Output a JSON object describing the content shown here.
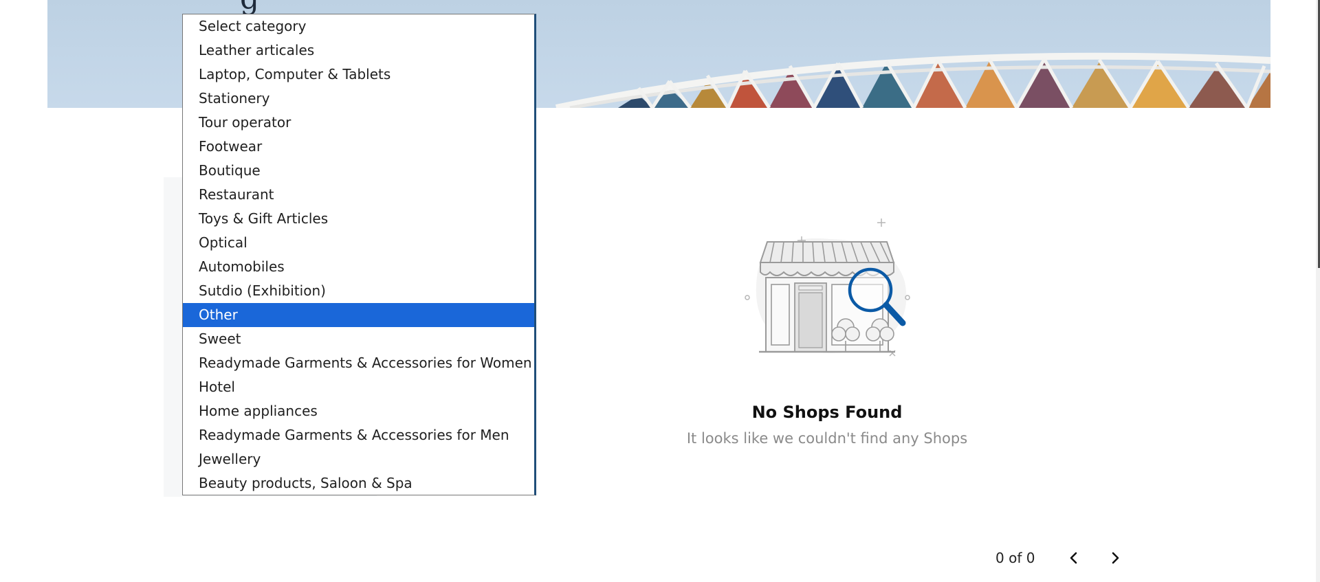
{
  "hero": {
    "title_fragment": "g"
  },
  "dropdown": {
    "options": [
      "Select category",
      "Leather articales",
      "Laptop, Computer & Tablets",
      "Stationery",
      "Tour operator",
      "Footwear",
      "Boutique",
      "Restaurant",
      "Toys & Gift Articles",
      "Optical",
      "Automobiles",
      "Sutdio (Exhibition)",
      "Other",
      "Sweet",
      "Readymade Garments & Accessories for Women",
      "Hotel",
      "Home appliances",
      "Readymade Garments & Accessories for Men",
      "Jewellery",
      "Beauty products, Saloon & Spa"
    ],
    "selected": "Other"
  },
  "empty_state": {
    "icon": "shop-search-icon",
    "title": "No Shops Found",
    "subtitle": "It looks like we couldn't find any Shops"
  },
  "pagination": {
    "count_text": "0 of 0",
    "prev_icon": "chevron-left-icon",
    "next_icon": "chevron-right-icon"
  },
  "colors": {
    "selected_bg": "#1a67d9",
    "accent_blue": "#0b5aa6",
    "hero_sky": "#c2d5e7"
  }
}
